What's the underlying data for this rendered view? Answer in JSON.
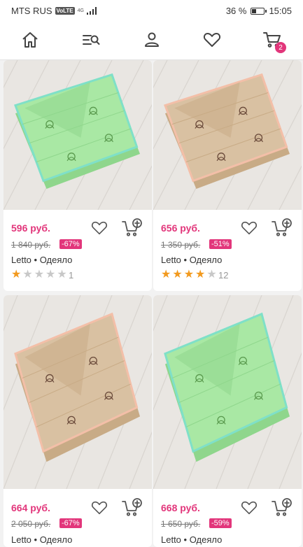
{
  "status_bar": {
    "carrier": "MTS RUS",
    "volte": "VoLTE",
    "network": "4G",
    "battery_percent": "36 %",
    "battery_level": 0.36,
    "time": "15:05"
  },
  "nav": {
    "icons": [
      "home-icon",
      "catalog-search-icon",
      "profile-icon",
      "favorites-icon",
      "cart-icon"
    ],
    "cart_count": "2"
  },
  "colors": {
    "accent": "#e2367b",
    "star": "#f29a1f",
    "background": "#f2f2f2"
  },
  "products": [
    {
      "price": "596 руб.",
      "old_price": "1 840 руб.",
      "discount": "-67%",
      "brand": "Letto",
      "separator": "•",
      "type": "Одеяло",
      "rating": 1,
      "max_rating": 5,
      "reviews": "1",
      "blanket_color": "green"
    },
    {
      "price": "656 руб.",
      "old_price": "1 350 руб.",
      "discount": "-51%",
      "brand": "Letto",
      "separator": "•",
      "type": "Одеяло",
      "rating": 4,
      "max_rating": 5,
      "reviews": "12",
      "blanket_color": "beige"
    },
    {
      "price": "664 руб.",
      "old_price": "2 050 руб.",
      "discount": "-67%",
      "brand": "Letto",
      "separator": "•",
      "type": "Одеяло",
      "blanket_color": "beige"
    },
    {
      "price": "668 руб.",
      "old_price": "1 650 руб.",
      "discount": "-59%",
      "brand": "Letto",
      "separator": "•",
      "type": "Одеяло",
      "blanket_color": "green"
    }
  ]
}
